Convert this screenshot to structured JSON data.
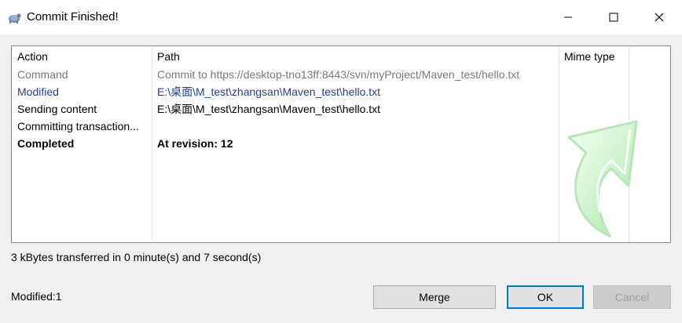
{
  "window": {
    "title": "Commit Finished!",
    "icons": {
      "app": "tortoise-icon",
      "minimize": "minimize-icon",
      "maximize": "maximize-icon",
      "close": "close-icon"
    }
  },
  "list": {
    "columns": [
      "Action",
      "Path",
      "Mime type"
    ],
    "rows": [
      {
        "action": "Command",
        "path": "Commit to https://desktop-tno13ff:8443/svn/myProject/Maven_test/hello.txt",
        "color": "#7a7a7a",
        "bold": false
      },
      {
        "action": "Modified",
        "path": "E:\\桌面\\M_test\\zhangsan\\Maven_test\\hello.txt",
        "color": "#1e3f9e",
        "bold": false
      },
      {
        "action": "Sending content",
        "path": "E:\\桌面\\M_test\\zhangsan\\Maven_test\\hello.txt",
        "color": "#000000",
        "bold": false
      },
      {
        "action": "Committing transaction...",
        "path": "",
        "color": "#000000",
        "bold": false
      },
      {
        "action": "Completed",
        "path": "At revision: 12",
        "color": "#000000",
        "bold": true
      }
    ],
    "decoration": "curved-arrow-icon"
  },
  "status": {
    "transfer": "3 kBytes transferred in 0 minute(s) and 7 second(s)",
    "modified": "Modified:1"
  },
  "buttons": {
    "merge": "Merge",
    "ok": "OK",
    "cancel": "Cancel"
  },
  "colors": {
    "accent": "#0078d7",
    "modified_text": "#1e3f9e",
    "command_text": "#7a7a7a"
  }
}
